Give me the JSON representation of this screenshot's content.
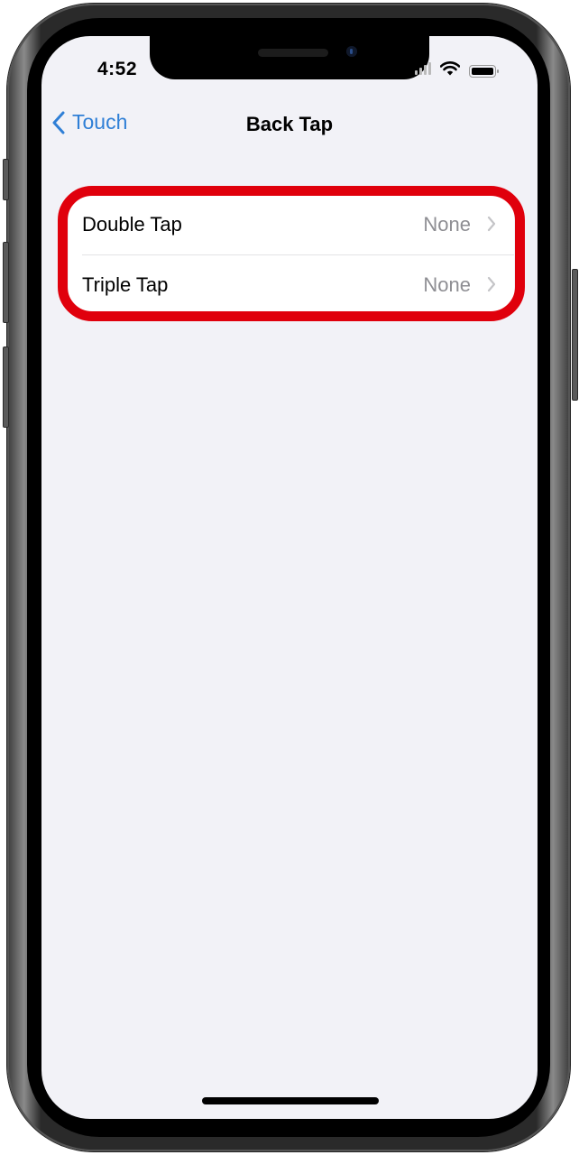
{
  "status_bar": {
    "time": "4:52",
    "icons": [
      "cellular-signal-icon",
      "wifi-icon",
      "battery-icon"
    ]
  },
  "nav": {
    "back_label": "Touch",
    "back_icon": "chevron-left-icon",
    "title": "Back Tap"
  },
  "settings": {
    "rows": [
      {
        "label": "Double Tap",
        "value": "None",
        "icon": "chevron-right-icon"
      },
      {
        "label": "Triple Tap",
        "value": "None",
        "icon": "chevron-right-icon"
      }
    ]
  },
  "colors": {
    "accent": "#2f7fd6",
    "highlight": "#e0000c",
    "background": "#f2f2f7",
    "secondary_text": "#8e8e93"
  }
}
